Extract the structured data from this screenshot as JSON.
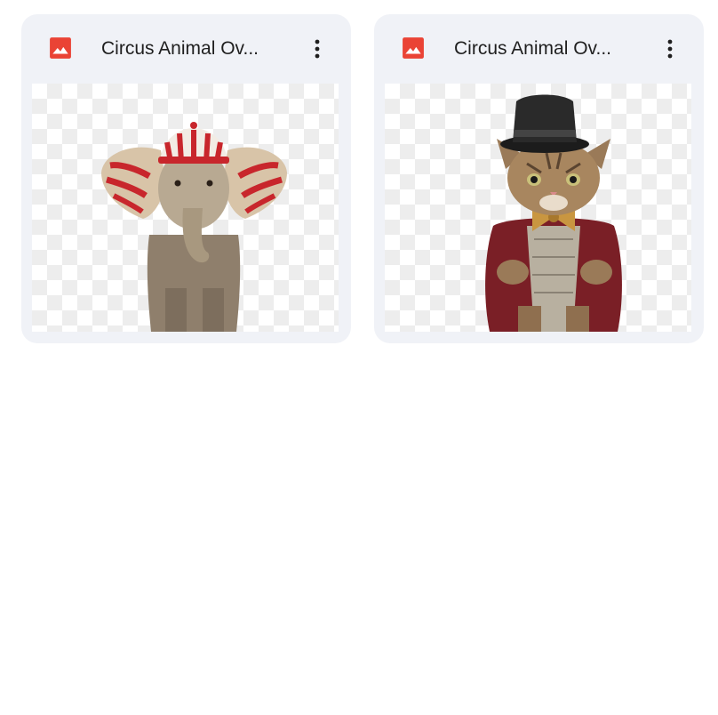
{
  "files": [
    {
      "title": "Circus Animal Ov...",
      "icon": "image-icon",
      "menu_icon": "more-vert-icon",
      "thumbnail": "elephant with red and white striped hat",
      "accent": "#ea4335"
    },
    {
      "title": "Circus Animal Ov...",
      "icon": "image-icon",
      "menu_icon": "more-vert-icon",
      "thumbnail": "kitten in top hat and red coat",
      "accent": "#ea4335"
    }
  ]
}
